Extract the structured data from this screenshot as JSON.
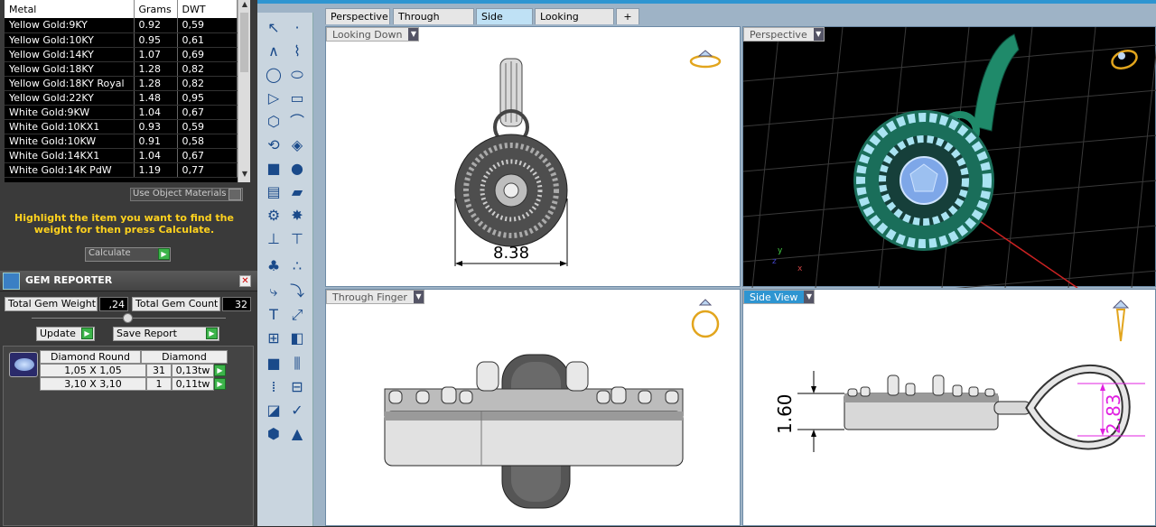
{
  "metal_table": {
    "headers": [
      "Metal",
      "Grams",
      "DWT"
    ],
    "rows": [
      [
        "Yellow Gold:9KY",
        "0.92",
        "0,59"
      ],
      [
        "Yellow Gold:10KY",
        "0.95",
        "0,61"
      ],
      [
        "Yellow Gold:14KY",
        "1.07",
        "0,69"
      ],
      [
        "Yellow Gold:18KY",
        "1.28",
        "0,82"
      ],
      [
        "Yellow Gold:18KY Royal",
        "1.28",
        "0,82"
      ],
      [
        "Yellow Gold:22KY",
        "1.48",
        "0,95"
      ],
      [
        "White Gold:9KW",
        "1.04",
        "0,67"
      ],
      [
        "White Gold:10KX1",
        "0.93",
        "0,59"
      ],
      [
        "White Gold:10KW",
        "0.91",
        "0,58"
      ],
      [
        "White Gold:14KX1",
        "1.04",
        "0,67"
      ],
      [
        "White Gold:14K PdW",
        "1.19",
        "0,77"
      ]
    ]
  },
  "use_object_materials": "Use Object Materials",
  "highlight_msg": "Highlight the item you want to find the weight for then press Calculate.",
  "calculate_label": "Calculate",
  "gem_reporter": {
    "title": "GEM REPORTER",
    "total_weight_label": "Total Gem Weight",
    "total_weight_value": ",24",
    "total_count_label": "Total Gem Count",
    "total_count_value": "32",
    "update_label": "Update",
    "save_report_label": "Save Report",
    "col_shape": "Diamond Round",
    "col_material": "Diamond",
    "rows": [
      {
        "size": "1,05 X 1,05",
        "count": "31",
        "weight": "0,13tw"
      },
      {
        "size": "3,10 X 3,10",
        "count": "1",
        "weight": "0,11tw"
      }
    ]
  },
  "tabs": [
    "Perspective",
    "Through Finger",
    "Side View",
    "Looking Down"
  ],
  "active_tab": "Side View",
  "viewports": {
    "looking_down": {
      "label": "Looking Down",
      "dimension": "8.38"
    },
    "perspective": {
      "label": "Perspective"
    },
    "through_finger": {
      "label": "Through Finger"
    },
    "side_view": {
      "label": "Side View",
      "dim_height": "1.60",
      "dim_bail": "2.83"
    }
  },
  "colors": {
    "accent": "#2e95d1",
    "gem_blue": "#7ea7e8",
    "green_metal": "#1f8a6a",
    "highlight": "#ffd21e"
  }
}
